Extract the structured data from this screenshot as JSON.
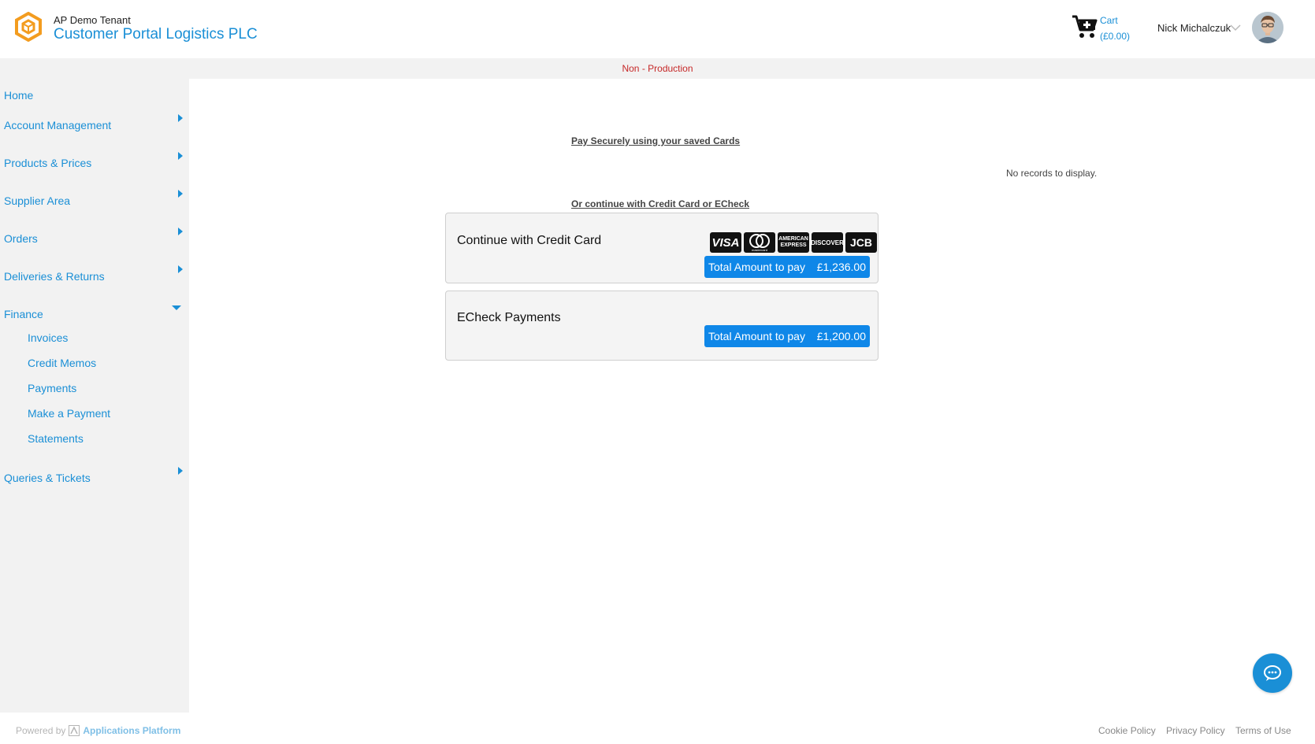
{
  "header": {
    "tenant": "AP Demo Tenant",
    "company": "Customer Portal Logistics PLC",
    "cart_label": "Cart",
    "cart_amount": "(£0.00)",
    "user_name": "Nick Michalczuk"
  },
  "env_banner": "Non - Production",
  "sidebar": {
    "items": [
      {
        "label": "Home"
      },
      {
        "label": "Account Management"
      },
      {
        "label": "Products & Prices"
      },
      {
        "label": "Supplier Area"
      },
      {
        "label": "Orders"
      },
      {
        "label": "Deliveries & Returns"
      },
      {
        "label": "Finance"
      },
      {
        "label": "Queries & Tickets"
      }
    ],
    "finance_sub": [
      {
        "label": "Invoices"
      },
      {
        "label": "Credit Memos"
      },
      {
        "label": "Payments"
      },
      {
        "label": "Make a Payment"
      },
      {
        "label": "Statements"
      }
    ]
  },
  "main": {
    "saved_cards_title": "Pay Securely using your saved Cards",
    "no_records": "No records to display.",
    "or_continue": "Or continue with Credit Card or ECheck",
    "credit_card": {
      "title": "Continue with Credit Card",
      "brands": [
        "VISA",
        "mastercard",
        "AMERICAN EXPRESS",
        "DISCOVER",
        "JCB"
      ],
      "total_label": "Total Amount to pay",
      "total_value": "£1,236.00"
    },
    "echeck": {
      "title": "ECheck Payments",
      "total_label": "Total Amount to pay",
      "total_value": "£1,200.00"
    }
  },
  "footer": {
    "powered_by": "Powered by",
    "platform": "Applications Platform",
    "links": [
      "Cookie Policy",
      "Privacy Policy",
      "Terms of Use"
    ]
  },
  "colors": {
    "accent": "#1a8fd6",
    "button": "#0f87e8",
    "banner_text": "#c62828",
    "logo": "#f39c1f"
  }
}
